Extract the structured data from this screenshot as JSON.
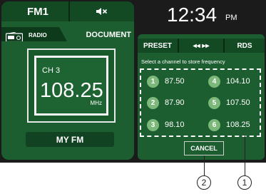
{
  "top_tabs": {
    "source": "FM1",
    "mute_icon": "speaker-mute-icon"
  },
  "source_row": {
    "radio_label": "RADIO",
    "document_label": "DOCUMENT"
  },
  "frequency_display": {
    "channel": "CH 3",
    "frequency": "108.25",
    "unit": "MHz"
  },
  "my_fm": "MY FM",
  "clock": {
    "time": "12:34",
    "ampm": "PM"
  },
  "right_tabs": {
    "preset": "PRESET",
    "seek": "◂◂ ▸▸",
    "rds": "RDS"
  },
  "instruction": "Select a channel to store frequency",
  "presets": [
    {
      "number": "1",
      "frequency": "87.50"
    },
    {
      "number": "2",
      "frequency": "87.90"
    },
    {
      "number": "3",
      "frequency": "98.10"
    },
    {
      "number": "4",
      "frequency": "104.10"
    },
    {
      "number": "5",
      "frequency": "107.50"
    },
    {
      "number": "6",
      "frequency": "108.25"
    }
  ],
  "cancel_label": "CANCEL",
  "callouts": {
    "one": "1",
    "two": "2"
  },
  "colors": {
    "panel_green": "#1d5e30",
    "dark_green": "#134a24",
    "preset_circle": "#7bb87a",
    "screen_bg": "#1b1b1b"
  }
}
